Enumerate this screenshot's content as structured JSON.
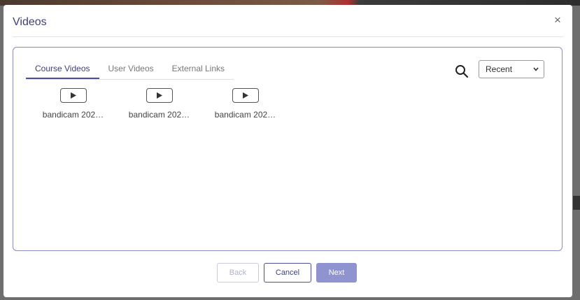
{
  "dialog": {
    "title": "Videos",
    "close_label": "×"
  },
  "tabs": [
    {
      "label": "Course Videos",
      "active": true
    },
    {
      "label": "User Videos",
      "active": false
    },
    {
      "label": "External Links",
      "active": false
    }
  ],
  "sort": {
    "selected": "Recent"
  },
  "videos": [
    {
      "label": "bandicam 202…"
    },
    {
      "label": "bandicam 202…"
    },
    {
      "label": "bandicam 202…"
    }
  ],
  "footer": {
    "back_label": "Back",
    "cancel_label": "Cancel",
    "next_label": "Next"
  },
  "colors": {
    "accent": "#4b4e9a",
    "next_button": "#8f93cf",
    "border": "#8a8cc2"
  },
  "icons": {
    "close": "close-icon",
    "search": "search-icon",
    "dropdown": "chevron-down-icon",
    "video": "video-play-icon"
  }
}
